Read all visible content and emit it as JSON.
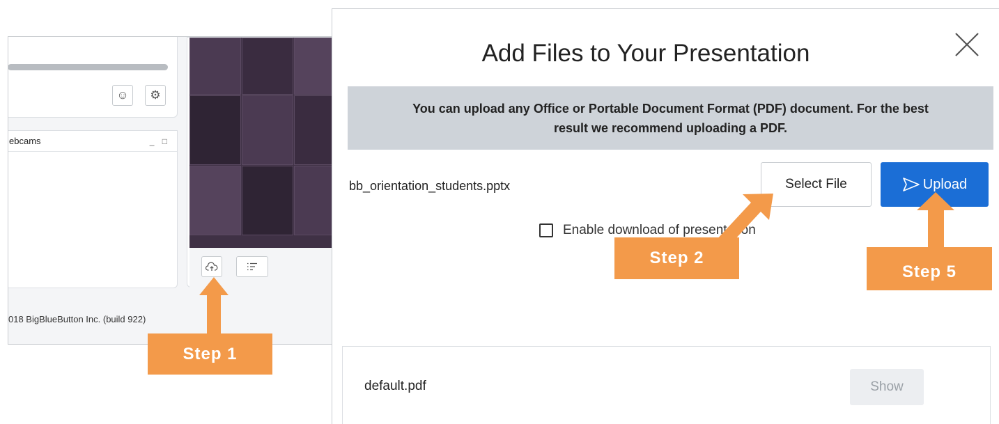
{
  "background_app": {
    "webcam_panel_title": "ebcams",
    "webcam_window_controls": "_ □",
    "footer": "018 BigBlueButton Inc. (build 922)",
    "emoji_icon": "smiley-icon",
    "settings_icon": "gear-icon",
    "upload_icon": "cloud-upload-icon",
    "list_icon": "list-icon"
  },
  "modal": {
    "title": "Add Files to Your Presentation",
    "info": "You can upload any Office or Portable Document Format (PDF) document.  For the best result we recommend uploading a PDF.",
    "selected_file": "bb_orientation_students.pptx",
    "select_file_label": "Select File",
    "upload_label": "Upload",
    "enable_download_label": "Enable download of presentation",
    "enable_download_checked": false,
    "files": [
      {
        "name": "default.pdf",
        "action": "Show"
      }
    ]
  },
  "steps": {
    "step1": "Step 1",
    "step2": "Step 2",
    "step5": "Step 5"
  },
  "colors": {
    "accent": "#1b6ed6",
    "callout": "#f39a4a",
    "info_bg": "#ced3d9"
  }
}
